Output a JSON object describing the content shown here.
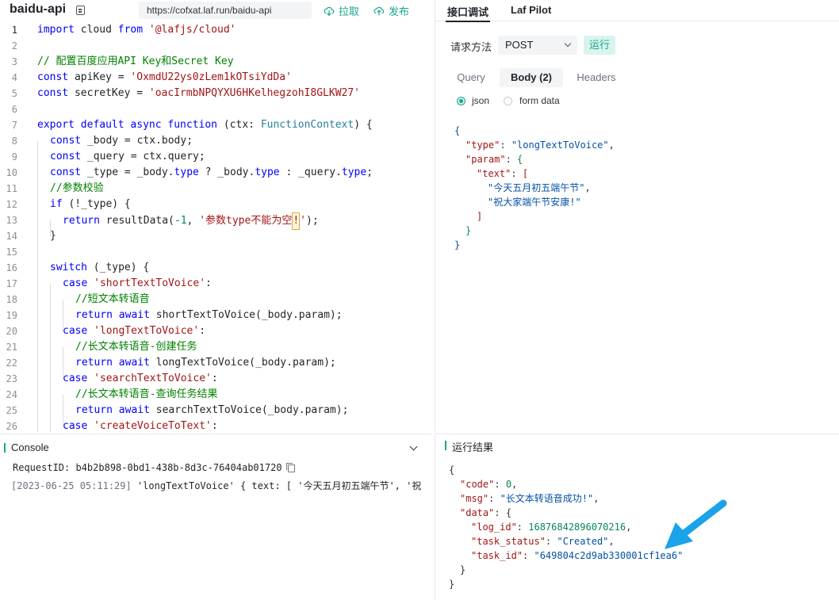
{
  "header": {
    "function_name": "baidu-api",
    "url": "https://cofxat.laf.run/baidu-api",
    "pull_label": "拉取",
    "publish_label": "发布"
  },
  "editor": {
    "line_numbers": [
      "1",
      "2",
      "3",
      "4",
      "5",
      "6",
      "7",
      "8",
      "9",
      "10",
      "11",
      "12",
      "13",
      "14",
      "15",
      "16",
      "17",
      "18",
      "19",
      "20",
      "21",
      "22",
      "23",
      "24",
      "25",
      "26"
    ]
  },
  "code_tokens": {
    "import": "import",
    "cloud": " cloud ",
    "from": "from",
    "import_path": " '@lafjs/cloud'",
    "comment_config": "// 配置百度应用API Key和Secret Key",
    "const": "const",
    "apikey_decl": " apiKey = ",
    "apikey_val": "'OxmdU22ys0zLem1kOTsiYdDa'",
    "secretkey_decl": " secretKey = ",
    "secretkey_val": "'oacIrmbNPQYXU6HKelhegzohI8GLKW27'",
    "export": "export",
    "default": " default ",
    "async": "async",
    "function": " function",
    "ctx_open": " (ctx: ",
    "fn_context": "FunctionContext",
    "ctx_close": ") {",
    "body_decl": " _body = ctx.body;",
    "query_decl": " _query = ctx.query;",
    "type_decl_a": " _type = _body.",
    "type_word": "type",
    "type_decl_b": " ? _body.",
    "type_decl_c": " : _query.",
    "type_decl_d": ";",
    "comment_check": "//参数校验",
    "if": "if",
    "if_cond": " (!_type) {",
    "return": "return",
    "result_call_a": " resultData(",
    "neg_one": "-1",
    "result_call_b": ", ",
    "err_str_a": "'参数type不能为空",
    "err_bang": "!",
    "err_str_b": "'",
    "result_call_c": ");",
    "brace_close": "}",
    "switch": "switch",
    "switch_cond": " (_type) {",
    "case": "case",
    "case_short": " 'shortTextToVoice'",
    "colon": ":",
    "comment_short": "//短文本转语音",
    "await": " await",
    "short_call": " shortTextToVoice(_body.param);",
    "case_long": " 'longTextToVoice'",
    "comment_long": "//长文本转语音-创建任务",
    "long_call": " longTextToVoice(_body.param);",
    "case_search": " 'searchTextToVoice'",
    "comment_search": "//长文本转语音-查询任务结果",
    "search_call": " searchTextToVoice(_body.param);",
    "case_create": " 'createVoiceToText'"
  },
  "right_panel": {
    "tabs": [
      "接口调试",
      "Laf Pilot"
    ],
    "method_label": "请求方法",
    "method_value": "POST",
    "run_label": "运行",
    "sub_tabs": [
      "Query",
      "Body (2)",
      "Headers"
    ],
    "body_types": [
      "json",
      "form data"
    ],
    "body_json": {
      "open": "{",
      "type_key": "\"type\"",
      "type_val": "\"longTextToVoice\"",
      "param_key": "\"param\"",
      "param_open": "{",
      "text_key": "\"text\"",
      "text_open": "[",
      "text_1": "\"今天五月初五端午节\"",
      "text_2": "\"祝大家端午节安康!\"",
      "text_close": "]",
      "param_close": "}",
      "close": "}"
    }
  },
  "console": {
    "title": "Console",
    "request_id": "RequestID: b4b2b898-0bd1-438b-8d3c-76404ab01720",
    "log_timestamp": "[2023-06-25 05:11:29]",
    "log_text": " 'longTextToVoice' { text: [ '今天五月初五端午节', '祝"
  },
  "result": {
    "title": "运行结果",
    "open": "{",
    "code_key": "\"code\"",
    "code_val": "0",
    "msg_key": "\"msg\"",
    "msg_val": "\"长文本转语音成功!\"",
    "data_key": "\"data\"",
    "data_open": "{",
    "log_id_key": "\"log_id\"",
    "log_id_val": "16876842896070216",
    "task_status_key": "\"task_status\"",
    "task_status_val": "\"Created\"",
    "task_id_key": "\"task_id\"",
    "task_id_val": "\"649804c2d9ab330001cf1ea6\"",
    "data_close": "}",
    "close": "}"
  },
  "colors": {
    "accent": "#19a58f",
    "annotation_arrow": "#1aa3e8"
  }
}
